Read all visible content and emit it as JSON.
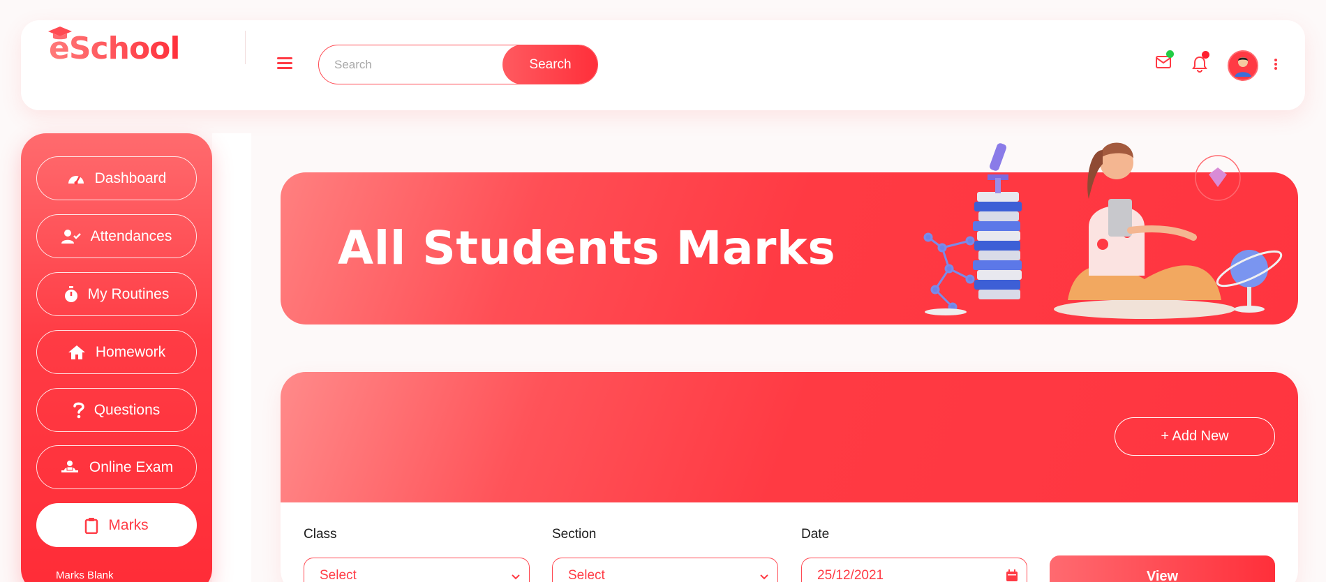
{
  "brand": {
    "name": "eSchool"
  },
  "header": {
    "search_placeholder": "Search",
    "search_button": "Search",
    "icons": [
      "menu-icon",
      "mail-icon",
      "bell-icon",
      "avatar",
      "kebab-icon"
    ]
  },
  "sidebar": {
    "items": [
      {
        "label": "Dashboard",
        "icon": "gauge-icon"
      },
      {
        "label": "Attendances",
        "icon": "user-check-icon"
      },
      {
        "label": "My Routines",
        "icon": "stopwatch-icon"
      },
      {
        "label": "Homework",
        "icon": "home-icon"
      },
      {
        "label": "Questions",
        "icon": "question-icon"
      },
      {
        "label": "Online Exam",
        "icon": "exam-icon"
      },
      {
        "label": "Marks",
        "icon": "clipboard-icon",
        "active": true
      }
    ],
    "sub_items": [
      "Marks Blank"
    ]
  },
  "banner": {
    "title": "All Students Marks"
  },
  "card": {
    "add_button": "+ Add New",
    "filters": [
      {
        "label": "Class",
        "value": "Select"
      },
      {
        "label": "Section",
        "value": "Select"
      },
      {
        "label": "Date",
        "value": "25/12/2021"
      }
    ],
    "view_button": "View"
  },
  "colors": {
    "accent": "#ff3a44",
    "accent_light": "#ff8080",
    "online": "#22cc44"
  }
}
